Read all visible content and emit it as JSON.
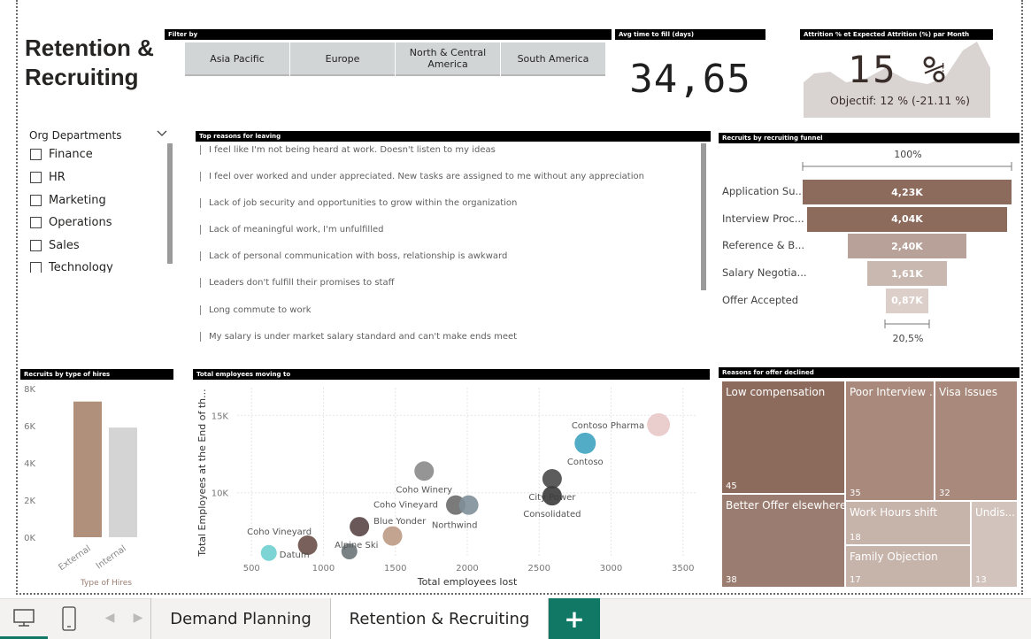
{
  "report": {
    "title": "Retention &\nRecruiting"
  },
  "filter": {
    "header": "Filter by",
    "buttons": [
      "Asia Pacific",
      "Europe",
      "North & Central America",
      "South America"
    ]
  },
  "kpi": {
    "header": "Avg time to fill (days)",
    "value": "34,65"
  },
  "attrition": {
    "header": "Attrition % et Expected Attrition (%) par Month",
    "value": "15 %",
    "indicator": "!",
    "goal": "Objectif: 12 % (-21.11 %)"
  },
  "slicer": {
    "title": "Org Departments",
    "items": [
      "Finance",
      "HR",
      "Marketing",
      "Operations",
      "Sales",
      "Technology"
    ]
  },
  "reasons": {
    "header": "Top reasons for leaving",
    "items": [
      "I feel like I'm not being heard at work. Doesn't listen to my ideas",
      "I feel over worked and under appreciated. New tasks are assigned to me without any appreciation",
      "Lack of job security and opportunities to grow within the organization",
      "Lack of meaningful work, I'm unfulfilled",
      "Lack of personal communication with boss, relationship is awkward",
      "Leaders don't fulfill their promises to staff",
      "Long commute to work",
      "My salary is under market salary standard and can't make ends meet"
    ]
  },
  "funnel": {
    "header": "Recruits by recruiting funnel",
    "top_pct": "100%",
    "bottom_pct": "20,5%",
    "stages": [
      {
        "label": "Application Su...",
        "value": 4230,
        "display": "4,23K",
        "color": "#8c6b5d"
      },
      {
        "label": "Interview Proc...",
        "value": 4040,
        "display": "4,04K",
        "color": "#8c6b5d"
      },
      {
        "label": "Reference & B...",
        "value": 2400,
        "display": "2,40K",
        "color": "#b8a198"
      },
      {
        "label": "Salary Negotia...",
        "value": 1610,
        "display": "1,61K",
        "color": "#c9b8b0"
      },
      {
        "label": "Offer Accepted",
        "value": 870,
        "display": "0,87K",
        "color": "#dccfc9"
      }
    ]
  },
  "declined": {
    "header": "Reasons for offer declined",
    "items": [
      {
        "label": "Low compensation",
        "value": "45",
        "color": "#8c6b5d"
      },
      {
        "label": "Better Offer elsewhere",
        "value": "38",
        "color": "#9a7d70"
      },
      {
        "label": "Poor Interview ...",
        "value": "35",
        "color": "#a8897b"
      },
      {
        "label": "Visa Issues",
        "value": "32",
        "color": "#a8897b"
      },
      {
        "label": "Work Hours shift",
        "value": "18",
        "color": "#c6b3aa"
      },
      {
        "label": "Family Objection",
        "value": "17",
        "color": "#c6b3aa"
      },
      {
        "label": "Undis...",
        "value": "13",
        "color": "#d2c4bd"
      }
    ]
  },
  "hires_chart": {
    "header": "Recruits by type of hires",
    "chart_data": {
      "type": "bar",
      "title": "Recruits by type of hires",
      "xlabel": "Type of Hires",
      "ylabel": "",
      "categories": [
        "External",
        "Internal"
      ],
      "values": [
        7300,
        5900
      ],
      "colors": [
        "#b0907a",
        "#d4d4d4"
      ],
      "ylim": [
        0,
        8000
      ],
      "yticks": [
        "0K",
        "2K",
        "4K",
        "6K",
        "8K"
      ],
      "grid": false
    }
  },
  "moving_chart": {
    "header": "Total employees moving to",
    "chart_data": {
      "type": "scatter",
      "title": "Total employees moving to",
      "xlabel": "Total employees lost",
      "ylabel": "Total Employees at the End of th...",
      "xlim": [
        400,
        3600
      ],
      "ylim": [
        5800,
        16800
      ],
      "xticks": [
        "500",
        "1000",
        "1500",
        "2000",
        "2500",
        "3000",
        "3500"
      ],
      "yticks": [
        "10K",
        "15K"
      ],
      "grid": true,
      "points": [
        {
          "name": "Contoso Pharma",
          "x": 3330,
          "y": 14400,
          "color": "#e8c9c9"
        },
        {
          "name": "Contoso",
          "x": 2820,
          "y": 13200,
          "color": "#3fa3c0"
        },
        {
          "name": "City Power",
          "x": 2590,
          "y": 10900,
          "color": "#4a4a4a"
        },
        {
          "name": "Consolidated",
          "x": 2590,
          "y": 9800,
          "color": "#3b3b3b"
        },
        {
          "name": "Coho Winery",
          "x": 1700,
          "y": 11400,
          "color": "#8a8a8a"
        },
        {
          "name": "Coho Vineyard",
          "x": 1920,
          "y": 9200,
          "color": "#6b6b6b"
        },
        {
          "name": "Northwind",
          "x": 2010,
          "y": 9200,
          "color": "#7f8f99"
        },
        {
          "name": "Blue Yonder",
          "x": 1250,
          "y": 7800,
          "color": "#5a4545"
        },
        {
          "name": "Coho Vineyard",
          "x": 890,
          "y": 6600,
          "color": "#6b4f48"
        },
        {
          "name": "Alpine Ski",
          "x": 1180,
          "y": 6200,
          "color": "#6b7478"
        },
        {
          "name": "Datum",
          "x": 620,
          "y": 6100,
          "color": "#6ecfcf"
        },
        {
          "name": "",
          "x": 1480,
          "y": 7200,
          "color": "#bb9a84"
        }
      ]
    }
  },
  "tabs": {
    "items": [
      "Demand Planning",
      "Retention & Recruiting"
    ],
    "add": "+"
  }
}
